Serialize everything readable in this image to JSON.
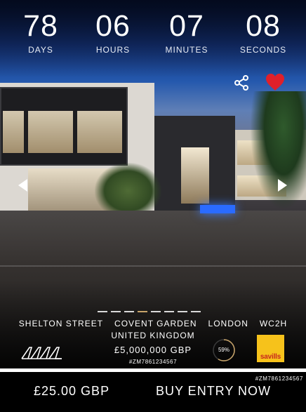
{
  "countdown": {
    "days": "78",
    "days_label": "DAYS",
    "hours": "06",
    "hours_label": "HOURS",
    "minutes": "07",
    "minutes_label": "MINUTES",
    "seconds": "08",
    "seconds_label": "SECONDS"
  },
  "icons": {
    "share": "share-icon",
    "favorite": "heart-icon",
    "prev": "chevron-left-icon",
    "next": "chevron-right-icon"
  },
  "colors": {
    "heart": "#e0202a",
    "dot_active": "#c8a46a",
    "savills_yellow": "#f6c21b",
    "savills_red": "#c8261d"
  },
  "carousel": {
    "slide_count": 8,
    "active_index": 3
  },
  "address": {
    "street": "SHELTON STREET",
    "area": "COVENT GARDEN",
    "city": "LONDON",
    "postcode": "WC2H",
    "country": "UNITED KINGDOM"
  },
  "price": "£5,000,000 GBP",
  "reference": "#ZM7861234567",
  "odds": {
    "label": "59%",
    "value": 0.59
  },
  "agent_logo": "savills",
  "footer": {
    "entry_fee": "£25.00 GBP",
    "buy_label": "BUY ENTRY NOW",
    "reference": "#ZM7861234567"
  }
}
